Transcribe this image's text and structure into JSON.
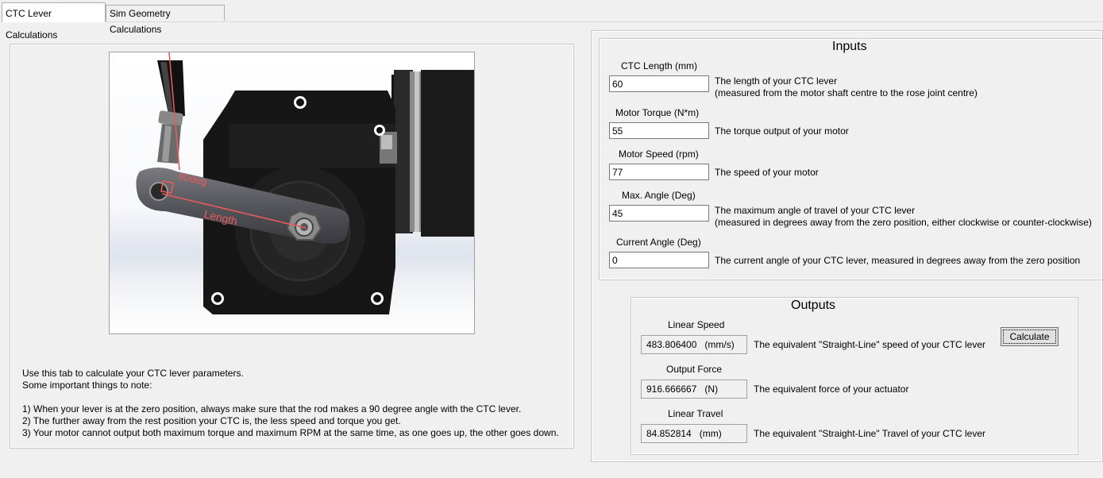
{
  "tabs": [
    {
      "label": "CTC Lever Calculations"
    },
    {
      "label": "Sim Geometry Calculations"
    }
  ],
  "diagram": {
    "angle_label": "90deg",
    "length_label": "Length"
  },
  "instructions": {
    "lines": [
      "Use this tab to calculate your CTC lever parameters.",
      "Some important things to note:",
      "",
      "1) When your lever is at the zero position, always make sure that the rod makes a 90 degree angle with the CTC lever.",
      "2) The further away from the rest position your CTC is, the less speed and torque you get.",
      "3) Your motor cannot output both maximum torque and maximum RPM at the same time, as one goes up, the other goes down."
    ]
  },
  "inputs": {
    "title": "Inputs",
    "fields": [
      {
        "label": "CTC Length (mm)",
        "value": "60",
        "desc1": "The length of your CTC lever",
        "desc2": "(measured from the motor shaft centre to the rose joint centre)"
      },
      {
        "label": "Motor Torque (N*m)",
        "value": "55",
        "desc1": "The torque output of your motor",
        "desc2": ""
      },
      {
        "label": "Motor Speed (rpm)",
        "value": "77",
        "desc1": "The speed of your motor",
        "desc2": ""
      },
      {
        "label": "Max. Angle (Deg)",
        "value": "45",
        "desc1": "The maximum angle of travel of your CTC lever",
        "desc2": "(measured in degrees away from the zero position, either clockwise or counter-clockwise)"
      },
      {
        "label": "Current Angle (Deg)",
        "value": "0",
        "desc1": "The current angle of your CTC lever, measured in degrees away from the zero position",
        "desc2": ""
      }
    ]
  },
  "outputs": {
    "title": "Outputs",
    "calculate_label": "Calculate",
    "fields": [
      {
        "label": "Linear Speed",
        "value": "483.806400   (mm/s)",
        "desc": "The equivalent \"Straight-Line\" speed of your CTC lever"
      },
      {
        "label": "Output Force",
        "value": "916.666667   (N)",
        "desc": "The equivalent force of your actuator"
      },
      {
        "label": "Linear Travel",
        "value": "84.852814   (mm)",
        "desc": "The equivalent \"Straight-Line\" Travel of your CTC lever"
      }
    ]
  },
  "colors": {
    "window_bg": "#f0f0f0",
    "annotation_red": "#e85a5a",
    "motor_body": "#161616"
  }
}
